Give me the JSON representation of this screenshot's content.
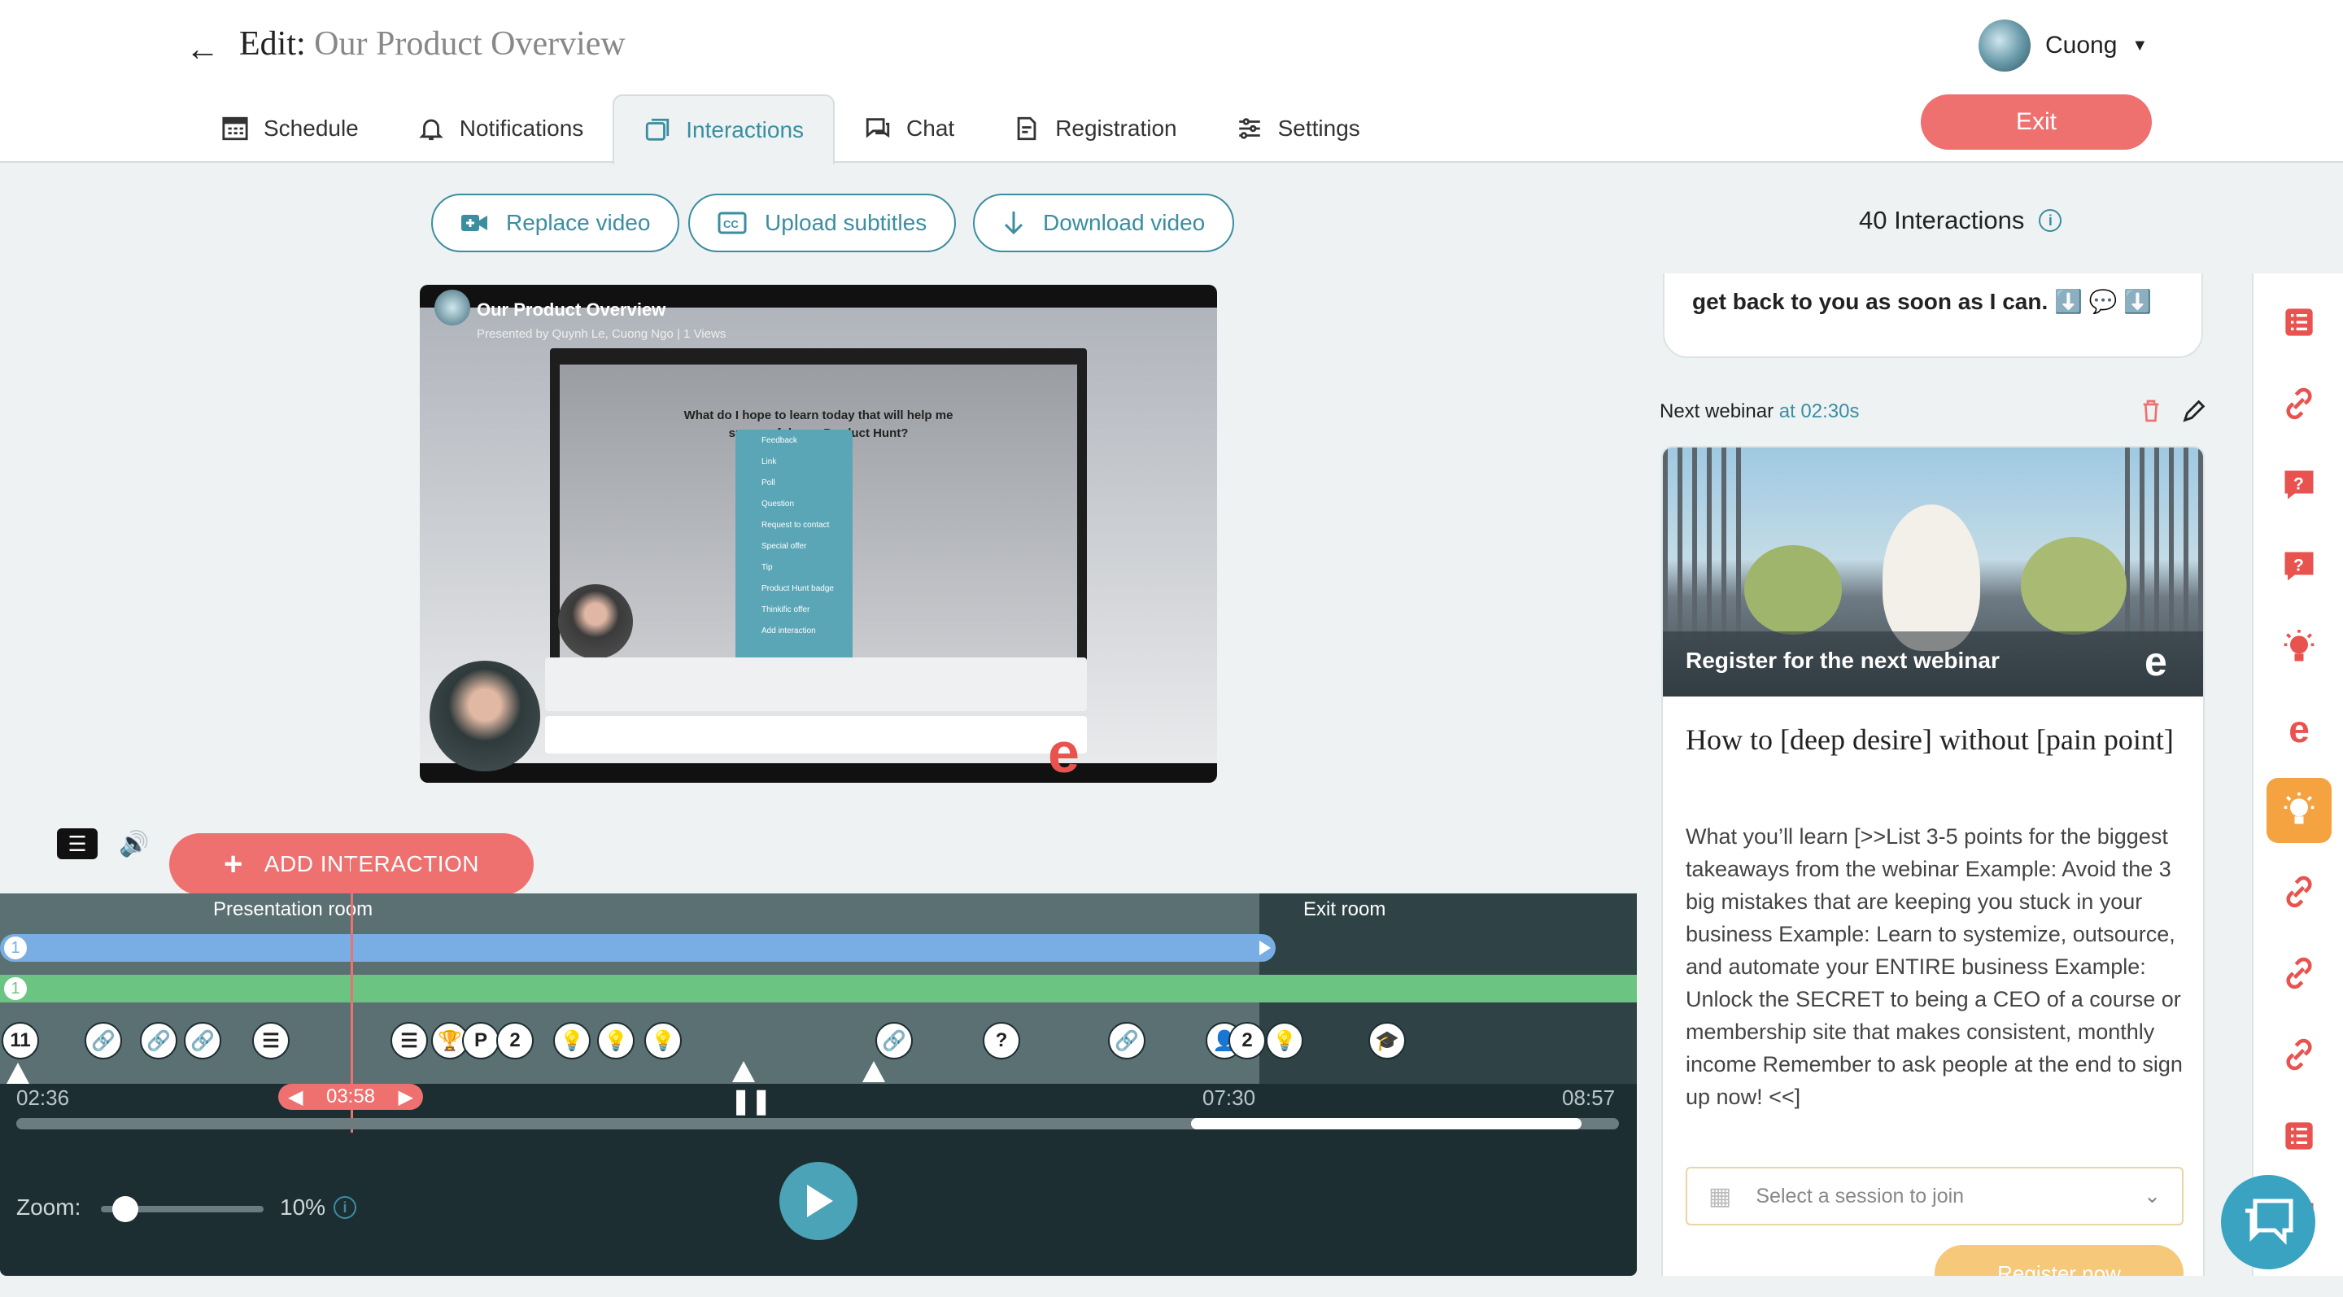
{
  "header": {
    "edit_label": "Edit:",
    "webinar_name": "Our Product Overview",
    "user_name": "Cuong",
    "exit_label": "Exit",
    "tabs": [
      {
        "label": "Schedule",
        "icon": "calendar-icon"
      },
      {
        "label": "Notifications",
        "icon": "bell-icon"
      },
      {
        "label": "Interactions",
        "icon": "interactions-icon",
        "active": true
      },
      {
        "label": "Chat",
        "icon": "chat-icon"
      },
      {
        "label": "Registration",
        "icon": "registration-icon"
      },
      {
        "label": "Settings",
        "icon": "sliders-icon"
      }
    ]
  },
  "toolbar": {
    "replace_video": "Replace video",
    "upload_subtitles": "Upload subtitles",
    "download_video": "Download video",
    "interactions_count": "40 Interactions"
  },
  "video": {
    "title": "Our Product Overview",
    "presenters": "Presented by Quynh Le, Cuong Ngo  |  1 Views",
    "question": "What do I hope to learn today that will help me successful... on Product Hunt?",
    "menu": [
      "Feedback",
      "Link",
      "Poll",
      "Question",
      "Request to contact",
      "Special offer",
      "Tip",
      "Product Hunt badge",
      "Thinkific offer",
      "Add interaction"
    ]
  },
  "controls": {
    "add_interaction": "ADD INTERACTION"
  },
  "timeline": {
    "presentation_room": "Presentation room",
    "exit_room": "Exit room",
    "blue_count": "1",
    "green_count": "1",
    "marker_first": "11",
    "marker_p2": "2",
    "marker_group": "2",
    "time_start": "02:36",
    "time_current": "03:58",
    "time_mid": "07:30",
    "time_end": "08:57",
    "zoom_label": "Zoom:",
    "zoom_value": "10%",
    "zoom_level": 0.1
  },
  "panel": {
    "prev_text": "get back to you as soon as I can. ⬇️ 💬 ⬇️",
    "next_label": "Next webinar",
    "next_time": "at 02:30s",
    "card_caption": "Register for the next webinar",
    "card_title": "How to [deep desire] without [pain point]",
    "card_description": "What you’ll learn [>>List 3-5 points for the biggest takeaways from the webinar Example: Avoid the 3 big mistakes that are keeping you stuck in your business Example: Learn to systemize, outsource, and automate your ENTIRE business Example: Unlock the SECRET to being a CEO of a course or membership site that makes consistent, monthly income Remember to ask people at the end to sign up now! <<]",
    "session_placeholder": "Select a session to join",
    "register_label": "Register now"
  },
  "colors": {
    "accent": "#3a8ea0",
    "exit_button": "#ee7170",
    "rail_icon": "#e8534f",
    "active_rail": "#f4a340",
    "blue_track": "#78aee4",
    "green_track": "#6cc483"
  },
  "rail_icons": [
    "list-icon",
    "link-icon",
    "question-icon",
    "question-icon",
    "tip-icon",
    "brand-e-icon",
    "tip-icon",
    "link-icon",
    "link-icon",
    "link-icon",
    "list-icon",
    "question-icon"
  ]
}
